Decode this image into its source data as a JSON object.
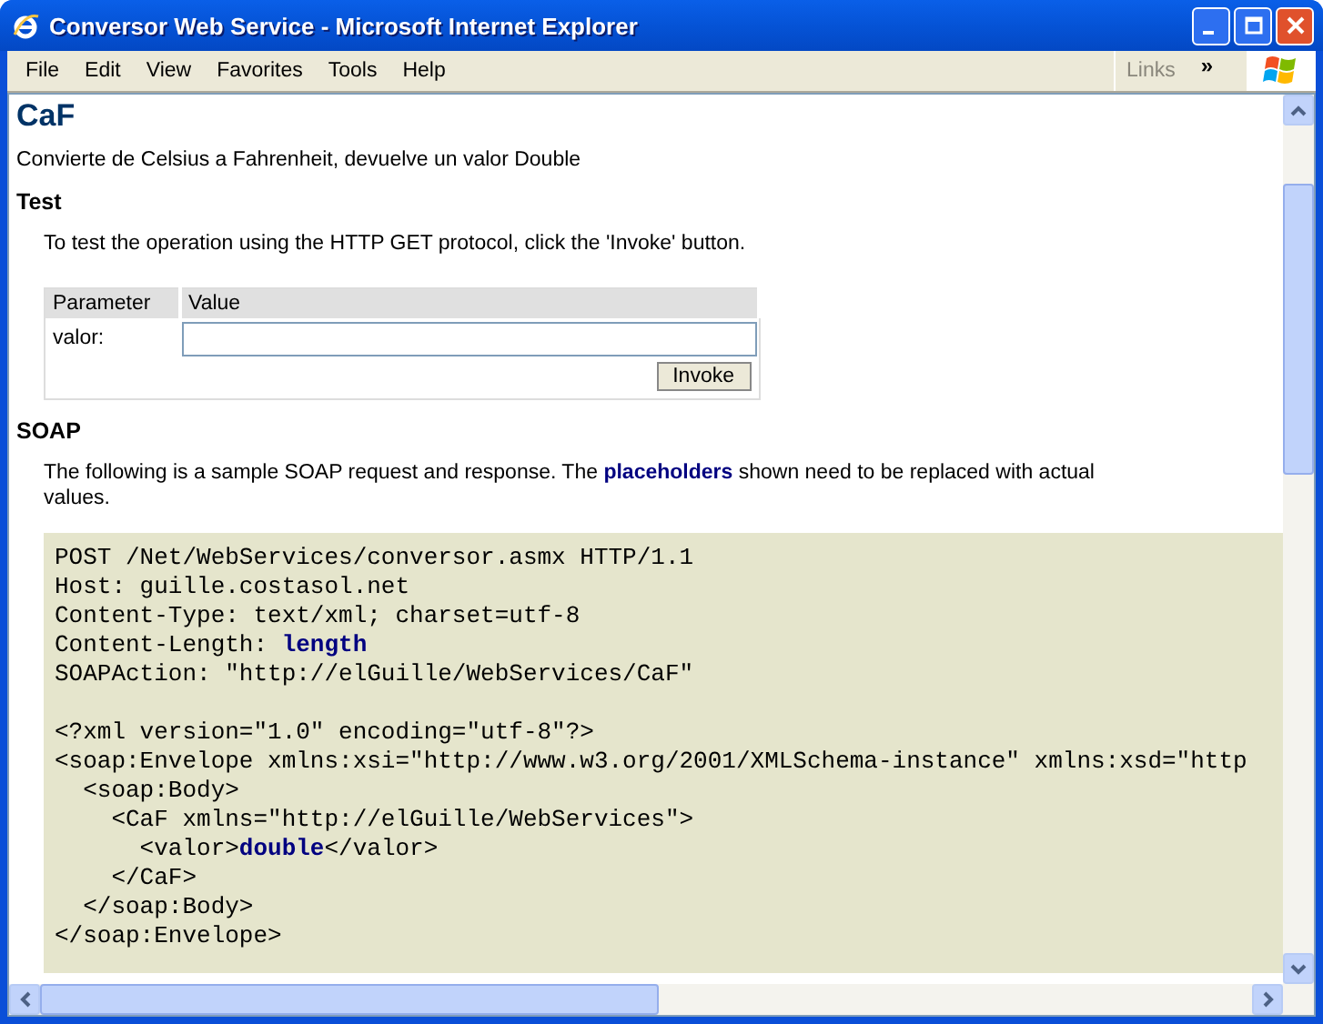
{
  "window": {
    "title": "Conversor Web Service - Microsoft Internet Explorer"
  },
  "menu": [
    "File",
    "Edit",
    "View",
    "Favorites",
    "Tools",
    "Help"
  ],
  "links_bar": {
    "label": "Links",
    "chevron": "»"
  },
  "page": {
    "heading": "CaF",
    "description": "Convierte de Celsius a Fahrenheit, devuelve un valor Double",
    "test": {
      "title": "Test",
      "intro": "To test the operation using the HTTP GET protocol, click the 'Invoke' button.",
      "columns": [
        "Parameter",
        "Value"
      ],
      "params": [
        {
          "label": "valor:"
        }
      ],
      "button": "Invoke"
    },
    "soap": {
      "title": "SOAP",
      "intro": "The following is a sample SOAP request and response. The **placeholders** shown need to be replaced with actual values.",
      "code_blocks": [
        [
          "POST /Net/WebServices/conversor.asmx HTTP/1.1",
          "Host: guille.costasol.net",
          "Content-Type: text/xml; charset=utf-8",
          "Content-Length: **length**",
          "SOAPAction: \"http://elGuille/WebServices/CaF\""
        ],
        [
          "<?xml version=\"1.0\" encoding=\"utf-8\"?>",
          "<soap:Envelope xmlns:xsi=\"http://www.w3.org/2001/XMLSchema-instance\" xmlns:xsd=\"http",
          "  <soap:Body>",
          "    <CaF xmlns=\"http://elGuille/WebServices\">",
          "      <valor>**double**</valor>",
          "    </CaF>",
          "  </soap:Body>",
          "</soap:Envelope>"
        ]
      ]
    }
  }
}
